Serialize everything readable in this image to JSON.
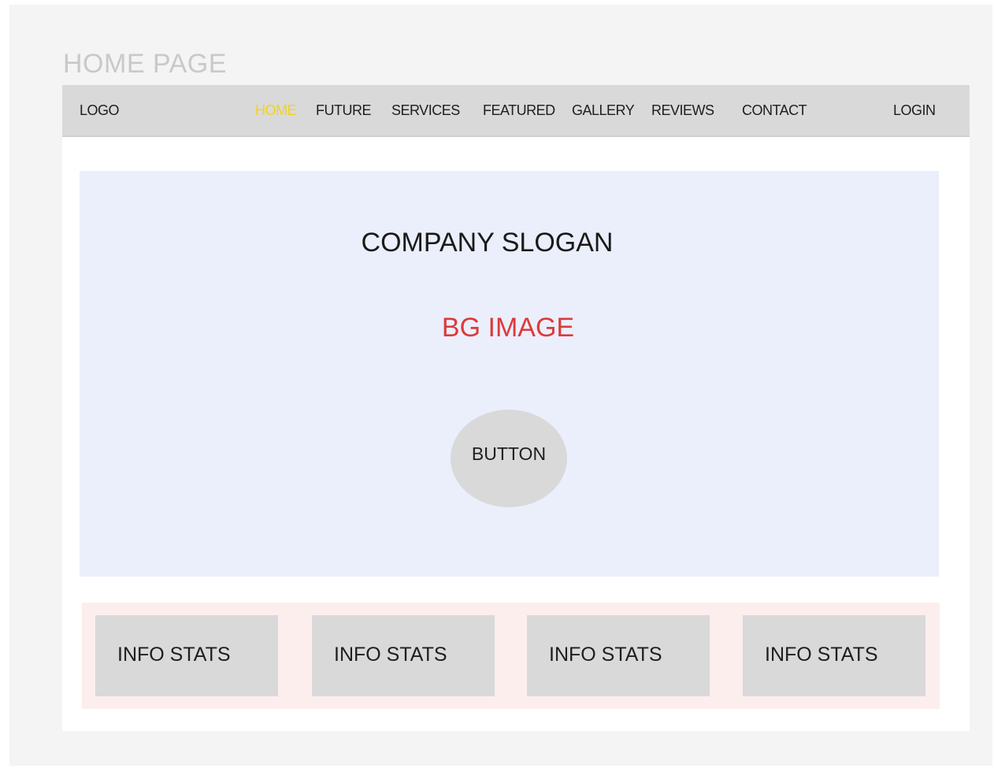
{
  "page_label": "HOME PAGE",
  "navbar": {
    "logo": "LOGO",
    "links": [
      {
        "label": "HOME",
        "active": true
      },
      {
        "label": "FUTURE",
        "active": false
      },
      {
        "label": "SERVICES",
        "active": false
      },
      {
        "label": "FEATURED",
        "active": false
      },
      {
        "label": "GALLERY",
        "active": false
      },
      {
        "label": "REVIEWS",
        "active": false
      },
      {
        "label": "CONTACT",
        "active": false
      }
    ],
    "login": "LOGIN"
  },
  "hero": {
    "slogan": "COMPANY SLOGAN",
    "bg_label": "BG IMAGE",
    "button_label": "BUTTON"
  },
  "stats": [
    {
      "label": "INFO STATS"
    },
    {
      "label": "INFO STATS"
    },
    {
      "label": "INFO STATS"
    },
    {
      "label": "INFO STATS"
    }
  ],
  "colors": {
    "active_nav": "#f5d21a",
    "bg_label": "#dc3a3a",
    "hero_background": "#ebeffc",
    "stats_background": "#fdeeee",
    "placeholder_gray": "#d9d9d9"
  }
}
